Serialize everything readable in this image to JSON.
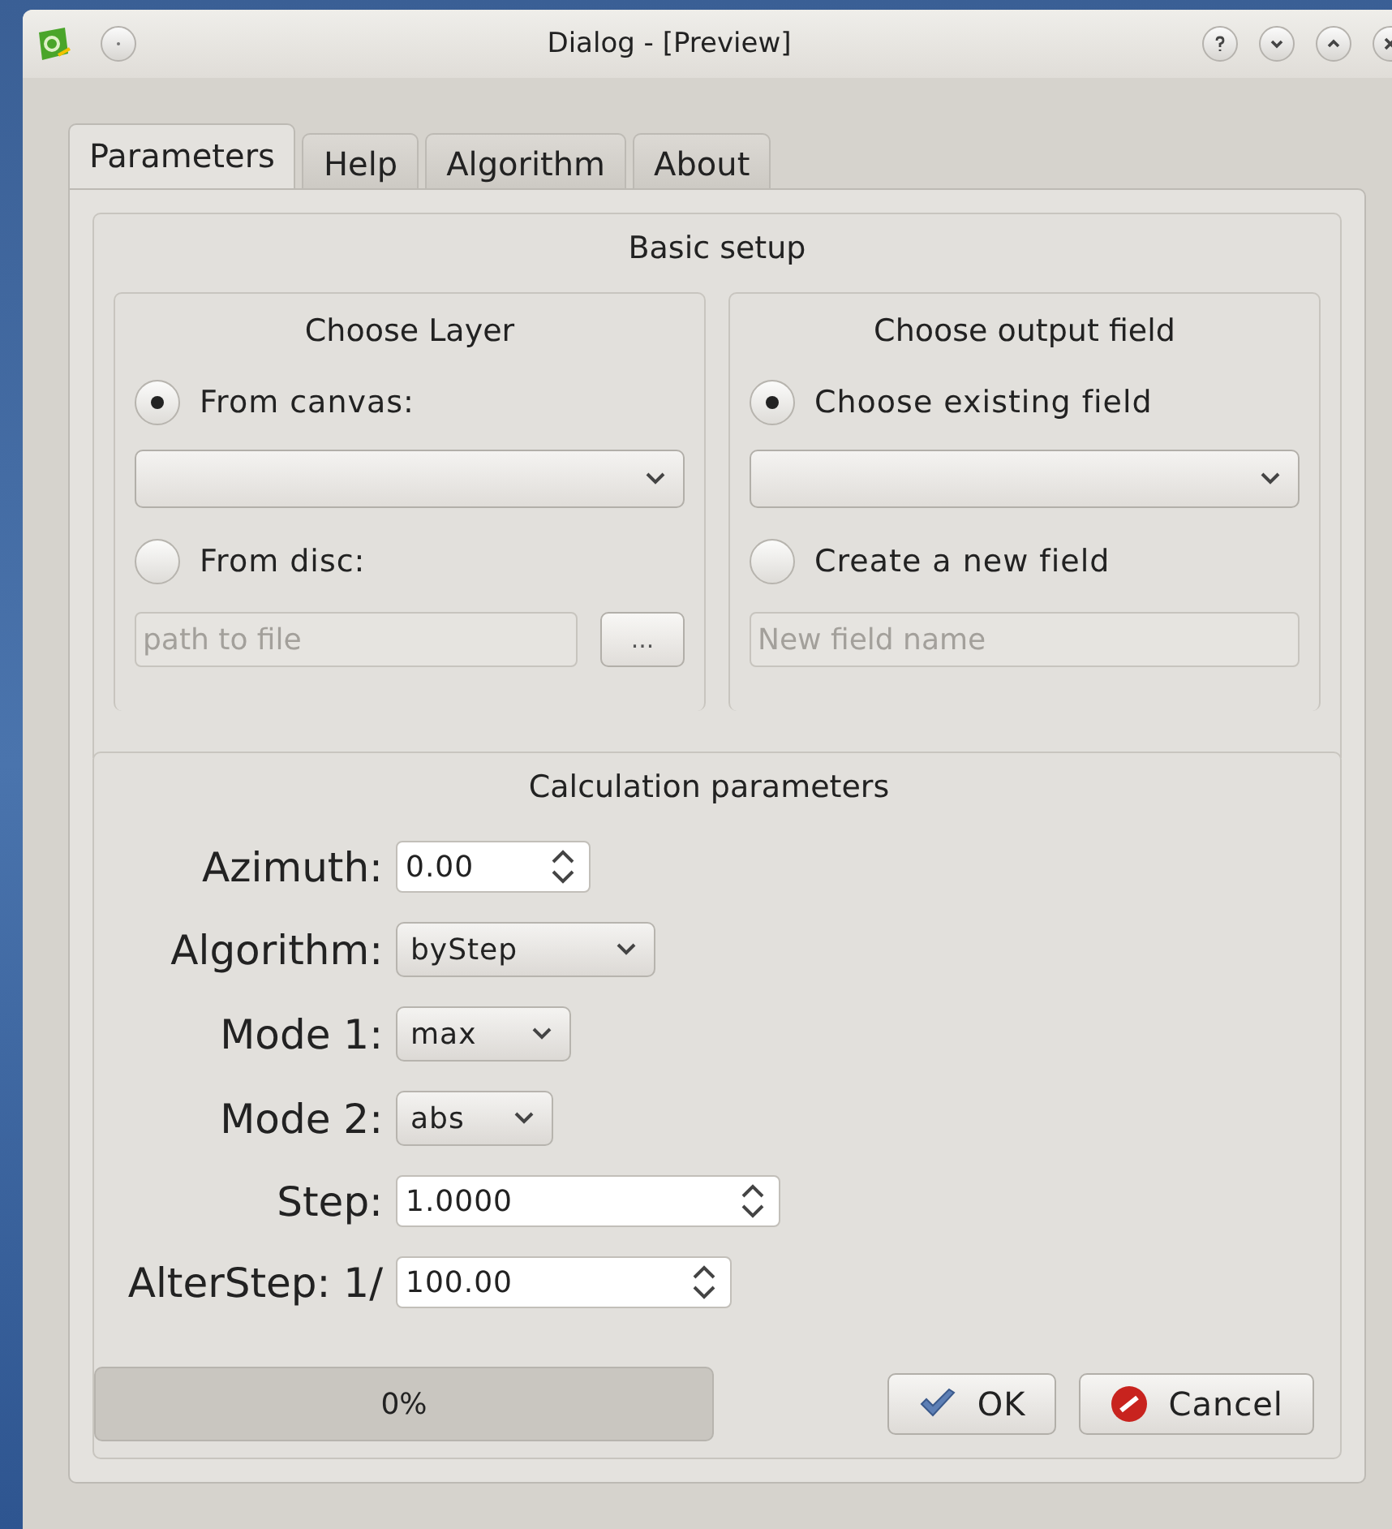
{
  "window": {
    "title": "Dialog - [Preview]"
  },
  "tabs": [
    {
      "label": "Parameters",
      "selected": true
    },
    {
      "label": "Help",
      "selected": false
    },
    {
      "label": "Algorithm",
      "selected": false
    },
    {
      "label": "About",
      "selected": false
    }
  ],
  "basic_setup": {
    "title": "Basic setup",
    "choose_layer": {
      "title": "Choose Layer",
      "from_canvas": {
        "label": "From canvas:",
        "selected": true
      },
      "from_disc": {
        "label": "From disc:",
        "selected": false
      },
      "path": {
        "placeholder": "path to file"
      },
      "browse_button": "..."
    },
    "choose_output": {
      "title": "Choose output field",
      "existing": {
        "label": "Choose existing field",
        "selected": true
      },
      "new_field": {
        "label": "Create a new field",
        "selected": false
      },
      "name": {
        "placeholder": "New field name"
      }
    }
  },
  "calculation": {
    "title": "Calculation parameters",
    "fields": [
      {
        "label": "Azimuth:",
        "kind": "spin",
        "value": "0.00"
      },
      {
        "label": "Algorithm:",
        "kind": "combo",
        "value": "byStep"
      },
      {
        "label": "Mode 1:",
        "kind": "combo",
        "value": "max"
      },
      {
        "label": "Mode 2:",
        "kind": "combo",
        "value": "abs"
      },
      {
        "label": "Step:",
        "kind": "spin",
        "value": "1.0000"
      },
      {
        "label": "AlterStep: 1/",
        "kind": "spin",
        "value": "100.00"
      }
    ]
  },
  "progress": {
    "level": 0,
    "reading": "0%"
  },
  "buttons": [
    {
      "label": "OK",
      "kind": "ok"
    },
    {
      "label": "Cancel",
      "kind": "cancel"
    }
  ]
}
